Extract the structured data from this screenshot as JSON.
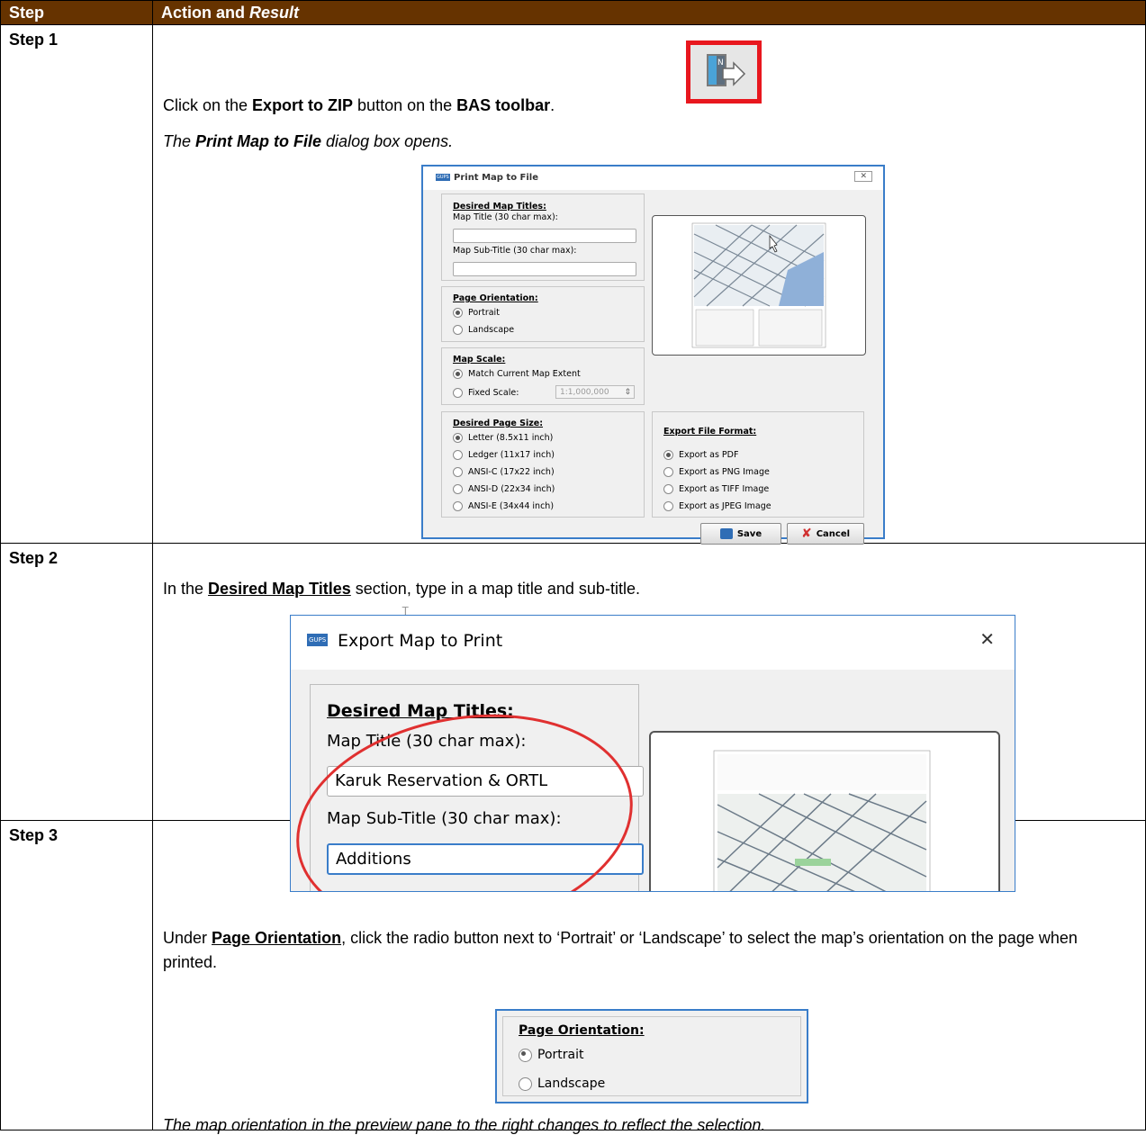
{
  "table": {
    "header_step": "Step",
    "header_action_plain": "Action and ",
    "header_action_italic": "Result"
  },
  "step1": {
    "label": "Step 1",
    "text_pre": "Click on the ",
    "text_bold1": "Export to ZIP",
    "text_mid": " button on the ",
    "text_bold2": "BAS toolbar",
    "text_end": ".",
    "result_pre": "The ",
    "result_bold": "Print Map to File",
    "result_post": " dialog box opens.",
    "toolbar_icon": "export-to-zip-icon",
    "highlight_color": "#e8171e",
    "dialog": {
      "title": "Print Map to File",
      "app_badge": "GUPS",
      "close_glyph": "✕",
      "titles_group": "Desired Map Titles:",
      "map_title_label": "Map Title (30 char max):",
      "map_title_value": "",
      "map_subtitle_label": "Map Sub-Title (30 char max):",
      "map_subtitle_value": "",
      "orientation_group": "Page Orientation:",
      "portrait": "Portrait",
      "landscape": "Landscape",
      "scale_group": "Map Scale:",
      "match_extent": "Match Current Map Extent",
      "fixed_scale": "Fixed Scale:",
      "fixed_scale_value": "1:1,000,000",
      "pagesize_group": "Desired Page Size:",
      "sizes": [
        "Letter (8.5x11 inch)",
        "Ledger (11x17 inch)",
        "ANSI-C (17x22 inch)",
        "ANSI-D (22x34 inch)",
        "ANSI-E (34x44 inch)"
      ],
      "format_group": "Export File Format:",
      "formats": [
        "Export as PDF",
        "Export as PNG Image",
        "Export as TIFF Image",
        "Export as JPEG Image"
      ],
      "save_label": "Save",
      "cancel_label": "Cancel"
    }
  },
  "step2": {
    "label": "Step 2",
    "text_pre": "In the ",
    "text_link": "Desired Map Titles",
    "text_post": " section, type in a map title and sub-title.",
    "dialog": {
      "title": "Export Map to Print",
      "app_badge": "GUPS",
      "close_glyph": "✕",
      "group_title": "Desired Map Titles:",
      "map_title_label": "Map Title (30 char max):",
      "map_title_value": "Karuk Reservation & ORTL",
      "map_subtitle_label": "Map Sub-Title (30 char max):",
      "map_subtitle_value": "Additions",
      "annotation_color": "#e03030"
    }
  },
  "step3": {
    "label": "Step 3",
    "text_pre": "Under ",
    "text_link": "Page Orientation",
    "text_post": ", click the radio button next to ‘Portrait’ or ‘Landscape’ to select the map’s orientation on the page when printed.",
    "crop": {
      "group_title": "Page Orientation:",
      "portrait": "Portrait",
      "landscape": "Landscape",
      "selected": "Portrait"
    },
    "result": "The map orientation in the preview pane to the right changes to reflect the selection."
  },
  "colors": {
    "header_bg": "#663300",
    "dialog_border": "#3a7dc9"
  }
}
